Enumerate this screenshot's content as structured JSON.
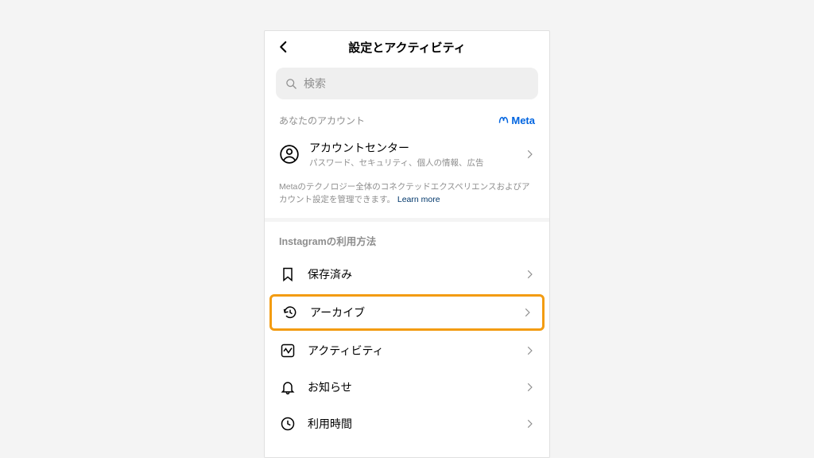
{
  "header": {
    "title": "設定とアクティビティ"
  },
  "search": {
    "placeholder": "検索"
  },
  "account_section": {
    "title": "あなたのアカウント",
    "brand": "Meta",
    "center_title": "アカウントセンター",
    "center_sub": "パスワード、セキュリティ、個人の情報、広告",
    "desc": "Metaのテクノロジー全体のコネクテッドエクスペリエンスおよびアカウント設定を管理できます。",
    "learn_more": "Learn more"
  },
  "usage_section": {
    "title": "Instagramの利用方法",
    "items": [
      {
        "label": "保存済み"
      },
      {
        "label": "アーカイブ"
      },
      {
        "label": "アクティビティ"
      },
      {
        "label": "お知らせ"
      },
      {
        "label": "利用時間"
      }
    ]
  }
}
